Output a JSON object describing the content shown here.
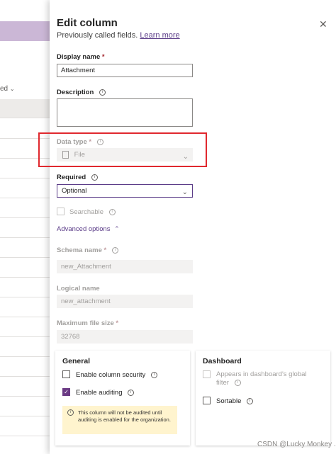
{
  "background": {
    "partial_text": "ed",
    "chevron": "chevron-down-icon"
  },
  "panel": {
    "title": "Edit column",
    "subtitle": "Previously called fields.",
    "learn_more": "Learn more",
    "close_icon": "close-icon"
  },
  "fields": {
    "display_name": {
      "label": "Display name",
      "required_mark": "*",
      "value": "Attachment"
    },
    "description": {
      "label": "Description",
      "value": ""
    },
    "data_type": {
      "label": "Data type",
      "required_mark": "*",
      "value": "File"
    },
    "required": {
      "label": "Required",
      "value": "Optional"
    },
    "searchable": {
      "label": "Searchable",
      "checked": false,
      "disabled": true
    },
    "advanced_options": {
      "label": "Advanced options"
    },
    "schema_name": {
      "label": "Schema name",
      "required_mark": "*",
      "value": "new_Attachment"
    },
    "logical_name": {
      "label": "Logical name",
      "value": "new_attachment"
    },
    "max_file_size": {
      "label": "Maximum file size",
      "required_mark": "*",
      "value": "32768"
    }
  },
  "general": {
    "title": "General",
    "enable_column_security": "Enable column security",
    "enable_auditing": "Enable auditing",
    "notice": "This column will not be audited until auditing is enabled for the organization."
  },
  "dashboard": {
    "title": "Dashboard",
    "appears_in_filter_line1": "Appears in dashboard's global",
    "appears_in_filter_line2": "filter",
    "sortable": "Sortable"
  },
  "watermark": "CSDN @Lucky Monkey .",
  "colors": {
    "accent": "#5b3c88",
    "checkbox_checked": "#6b3a84",
    "highlight_box": "#e0282e",
    "notice_bg": "#fff4ce"
  }
}
